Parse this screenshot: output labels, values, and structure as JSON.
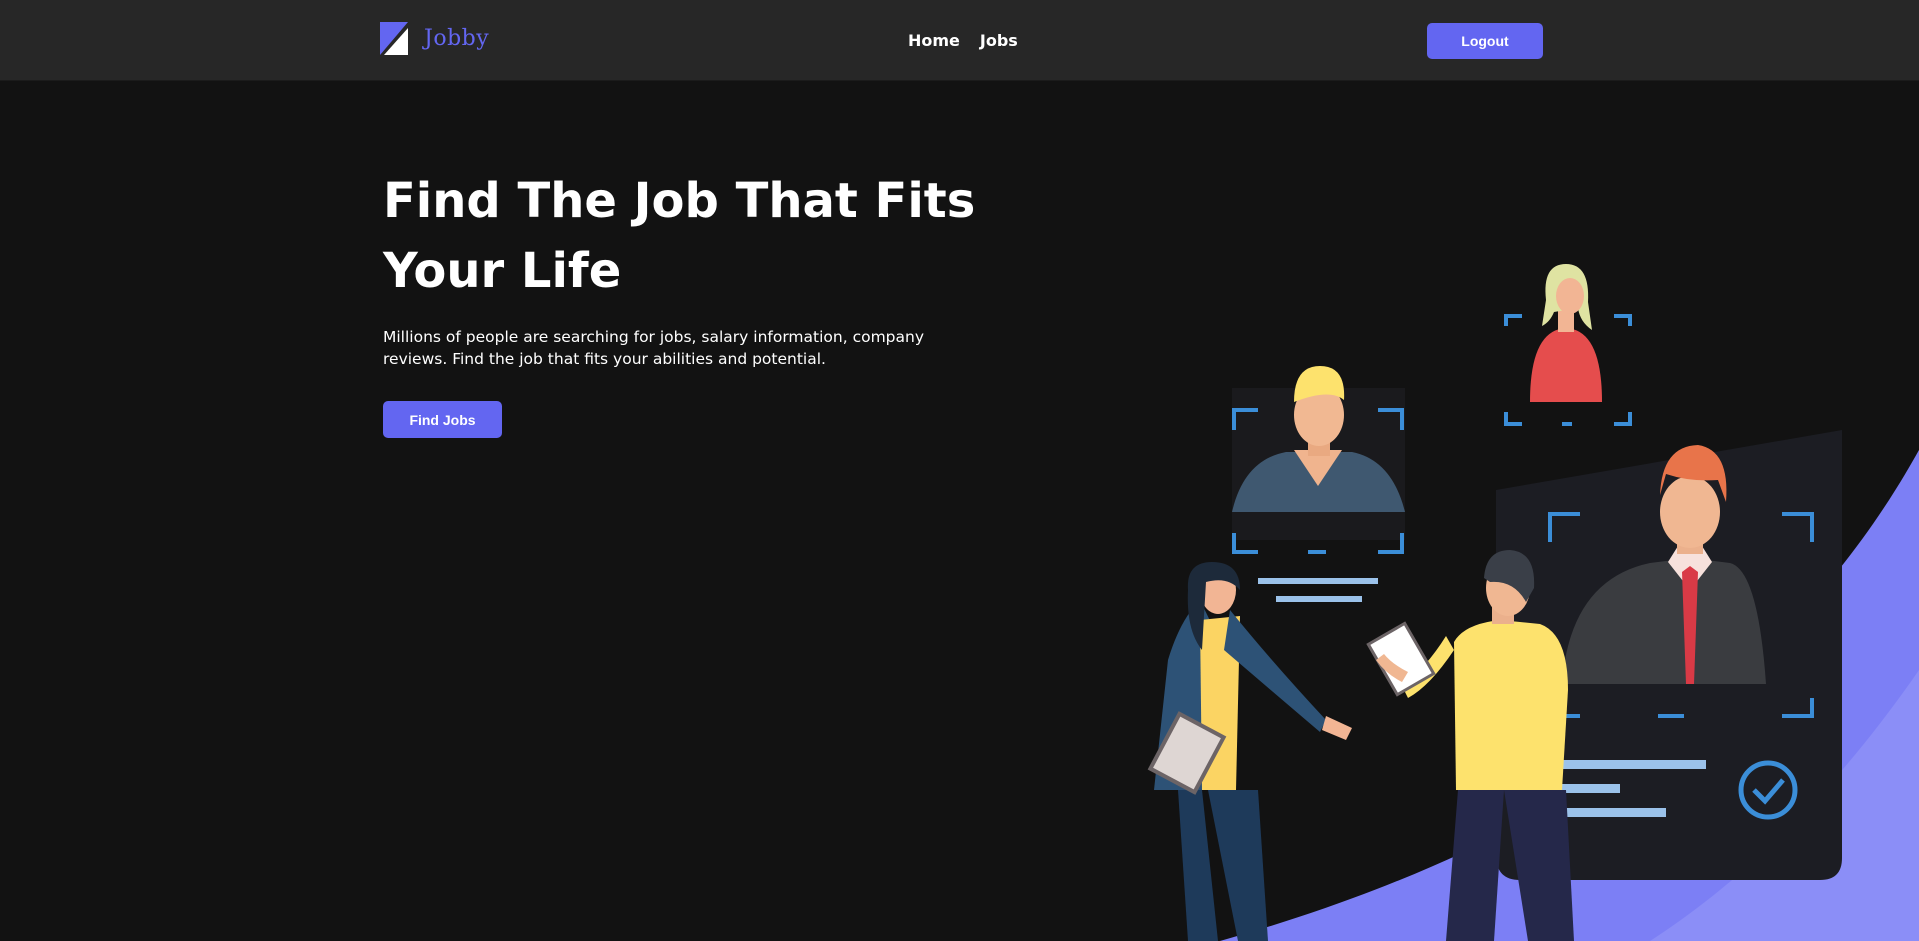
{
  "navbar": {
    "brand": "Jobby",
    "brand_color": "#6366f1",
    "links": [
      {
        "label": "Home"
      },
      {
        "label": "Jobs"
      }
    ],
    "logout_label": "Logout"
  },
  "hero": {
    "title": "Find The Job That Fits Your Life",
    "description": "Millions of people are searching for jobs, salary information, company reviews. Find the job that fits your abilities and potential.",
    "cta_label": "Find Jobs"
  },
  "colors": {
    "accent": "#6366f1",
    "background": "#121212",
    "navbar": "#272727",
    "illustration_wave": "#7c7ff5",
    "frame_blue": "#3b8ed8"
  }
}
